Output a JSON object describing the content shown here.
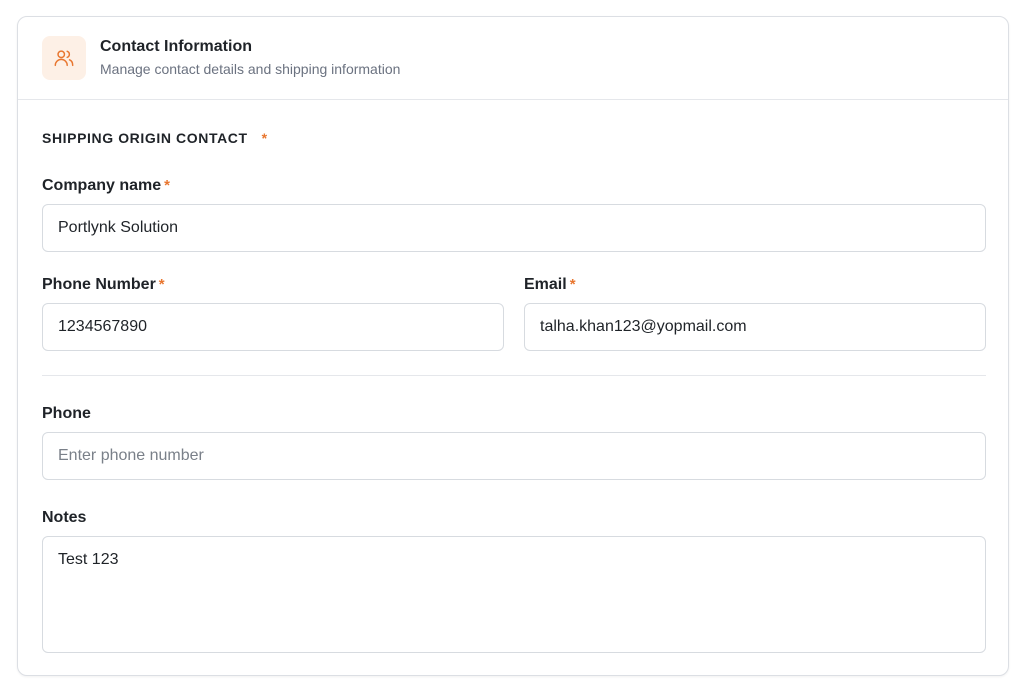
{
  "header": {
    "title": "Contact Information",
    "subtitle": "Manage contact details and shipping information",
    "icon": "users-icon",
    "accent_color": "#e8762f"
  },
  "section": {
    "title": "SHIPPING ORIGIN CONTACT",
    "required_mark": "*"
  },
  "fields": {
    "company_name": {
      "label": "Company name",
      "required_mark": "*",
      "value": "Portlynk Solution"
    },
    "phone_number": {
      "label": "Phone Number",
      "required_mark": "*",
      "value": "1234567890"
    },
    "email": {
      "label": "Email",
      "required_mark": "*",
      "value": "talha.khan123@yopmail.com"
    },
    "phone": {
      "label": "Phone",
      "value": "",
      "placeholder": "Enter phone number"
    },
    "notes": {
      "label": "Notes",
      "value": "Test 123"
    }
  }
}
